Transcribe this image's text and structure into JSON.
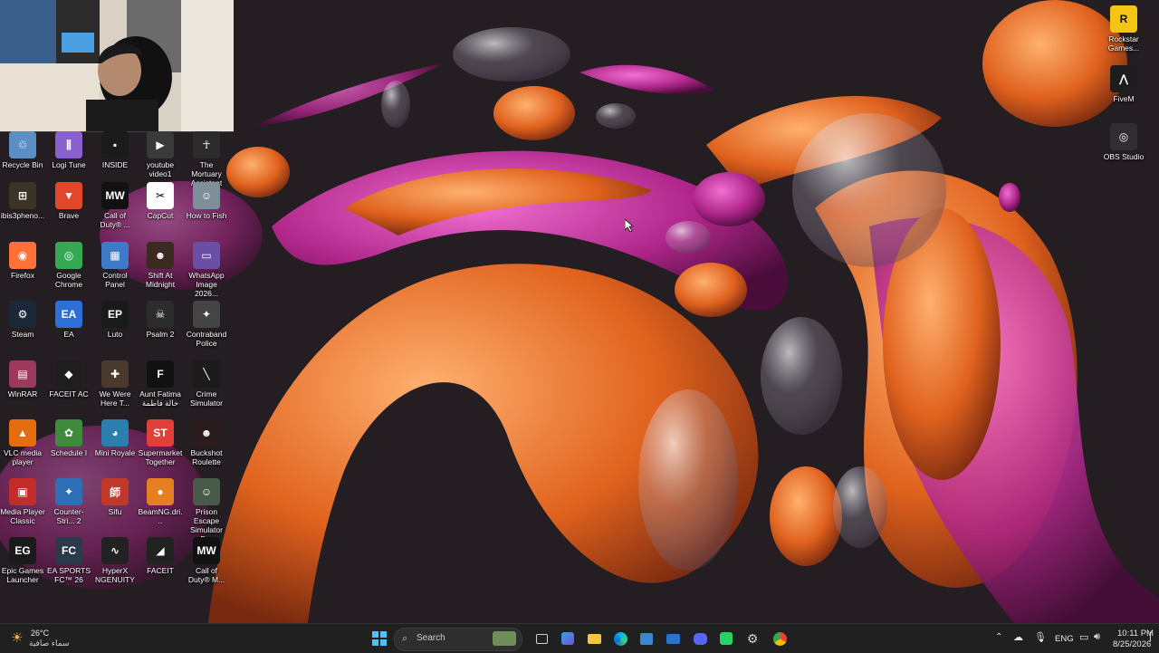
{
  "desktop": {
    "icons_left": [
      {
        "label": "Recycle Bin",
        "icon": "recycle-bin-icon",
        "bg": "#5b8fc4",
        "glyph": "♲"
      },
      {
        "label": "Logi Tune",
        "icon": "logi-tune-icon",
        "bg": "#8a5fd0",
        "glyph": "⫼"
      },
      {
        "label": "INSIDE",
        "icon": "inside-icon",
        "bg": "#1b1b1b",
        "glyph": "▪"
      },
      {
        "label": "youtube video1",
        "icon": "video-file-icon",
        "bg": "#3a3a3a",
        "glyph": "▶"
      },
      {
        "label": "The Mortuary Assistant",
        "icon": "mortuary-icon",
        "bg": "#2b2b2b",
        "glyph": "☥"
      },
      {
        "label": "ibis3pheno...",
        "icon": "game-icon",
        "bg": "#3b3326",
        "glyph": "⊞"
      },
      {
        "label": "Brave",
        "icon": "brave-icon",
        "bg": "#e2472b",
        "glyph": "▼"
      },
      {
        "label": "Call of Duty® ...",
        "icon": "cod-icon",
        "bg": "#111111",
        "glyph": "MW"
      },
      {
        "label": "CapCut",
        "icon": "capcut-icon",
        "bg": "#ffffff",
        "glyph": "✂"
      },
      {
        "label": "How to Fish",
        "icon": "how-to-fish-icon",
        "bg": "#7f8f9a",
        "glyph": "☺"
      },
      {
        "label": "Firefox",
        "icon": "firefox-icon",
        "bg": "#ff7139",
        "glyph": "◉"
      },
      {
        "label": "Google Chrome",
        "icon": "chrome-icon",
        "bg": "#34a853",
        "glyph": "◎"
      },
      {
        "label": "Control Panel",
        "icon": "control-panel-icon",
        "bg": "#3d7bc8",
        "glyph": "▦"
      },
      {
        "label": "Shift At Midnight",
        "icon": "shift-midnight-icon",
        "bg": "#3a2a22",
        "glyph": "☻"
      },
      {
        "label": "WhatsApp Image 2026...",
        "icon": "image-file-icon",
        "bg": "#6b4fa5",
        "glyph": "▭"
      },
      {
        "label": "Steam",
        "icon": "steam-icon",
        "bg": "#1b2838",
        "glyph": "⚙"
      },
      {
        "label": "EA",
        "icon": "ea-icon",
        "bg": "#2d6fd6",
        "glyph": "EA"
      },
      {
        "label": "Luto",
        "icon": "epic-icon",
        "bg": "#1a1a1a",
        "glyph": "EP"
      },
      {
        "label": "Psalm 2",
        "icon": "psalm-icon",
        "bg": "#2c2c2c",
        "glyph": "☠"
      },
      {
        "label": "Contraband Police",
        "icon": "contraband-icon",
        "bg": "#444444",
        "glyph": "✦"
      },
      {
        "label": "WinRAR",
        "icon": "winrar-icon",
        "bg": "#9c3a5b",
        "glyph": "▤"
      },
      {
        "label": "FACEIT AC",
        "icon": "faceit-ac-icon",
        "bg": "#1e1e1e",
        "glyph": "◆"
      },
      {
        "label": "We Were Here T...",
        "icon": "we-were-here-icon",
        "bg": "#4b3a2b",
        "glyph": "✚"
      },
      {
        "label": "Aunt Fatima خالة فاطمة",
        "icon": "aunt-fatima-icon",
        "bg": "#111111",
        "glyph": "F"
      },
      {
        "label": "Crime Simulator",
        "icon": "crime-simulator-icon",
        "bg": "#1b1b1b",
        "glyph": "╲"
      },
      {
        "label": "VLC media player",
        "icon": "vlc-icon",
        "bg": "#e46e0d",
        "glyph": "▲"
      },
      {
        "label": "Schedule I",
        "icon": "schedule-icon",
        "bg": "#3e8b3e",
        "glyph": "✿"
      },
      {
        "label": "Mini Royale",
        "icon": "mini-royale-icon",
        "bg": "#2a7fb0",
        "glyph": "◕"
      },
      {
        "label": "Supermarket Together",
        "icon": "supermarket-icon",
        "bg": "#e0403a",
        "glyph": "ST"
      },
      {
        "label": "Buckshot Roulette",
        "icon": "buckshot-icon",
        "bg": "#2b1d1d",
        "glyph": "☻"
      },
      {
        "label": "Media Player Classic",
        "icon": "mpc-icon",
        "bg": "#c42b2b",
        "glyph": "▣"
      },
      {
        "label": "Counter-Stri... 2",
        "icon": "cs2-icon",
        "bg": "#2c6fb4",
        "glyph": "✦"
      },
      {
        "label": "Sifu",
        "icon": "sifu-icon",
        "bg": "#c0392b",
        "glyph": "師"
      },
      {
        "label": "BeamNG.dri...",
        "icon": "beamng-icon",
        "bg": "#e67e22",
        "glyph": "●"
      },
      {
        "label": "Prison Escape Simulator D...",
        "icon": "prison-escape-icon",
        "bg": "#4a5a4a",
        "glyph": "☺"
      },
      {
        "label": "Epic Games Launcher",
        "icon": "epic-games-icon",
        "bg": "#1a1a1a",
        "glyph": "EG"
      },
      {
        "label": "EA SPORTS FC™ 26",
        "icon": "ea-fc-icon",
        "bg": "#2a3a4a",
        "glyph": "FC"
      },
      {
        "label": "HyperX NGENUITY",
        "icon": "hyperx-icon",
        "bg": "#222222",
        "glyph": "∿"
      },
      {
        "label": "FACEIT",
        "icon": "faceit-icon",
        "bg": "#222222",
        "glyph": "◢"
      },
      {
        "label": "Call of Duty® M...",
        "icon": "cod-mw3-icon",
        "bg": "#111111",
        "glyph": "MW"
      }
    ],
    "icons_right": [
      {
        "label": "Rockstar Games...",
        "icon": "rockstar-icon",
        "bg": "#f4c514",
        "glyph": "R"
      },
      {
        "label": "FiveM",
        "icon": "fivem-icon",
        "bg": "#1d1d1d",
        "glyph": "⋀"
      },
      {
        "label": "OBS Studio",
        "icon": "obs-icon",
        "bg": "#302e31",
        "glyph": "◎"
      }
    ]
  },
  "taskbar": {
    "weather_temp": "26°C",
    "weather_desc": "سماء صافية",
    "search_placeholder": "Search",
    "language": "ENG",
    "time": "10:11 PM",
    "date": "8/25/2026"
  },
  "colors": {
    "taskbar_bg": "#202020",
    "accent": "#0078d4"
  }
}
